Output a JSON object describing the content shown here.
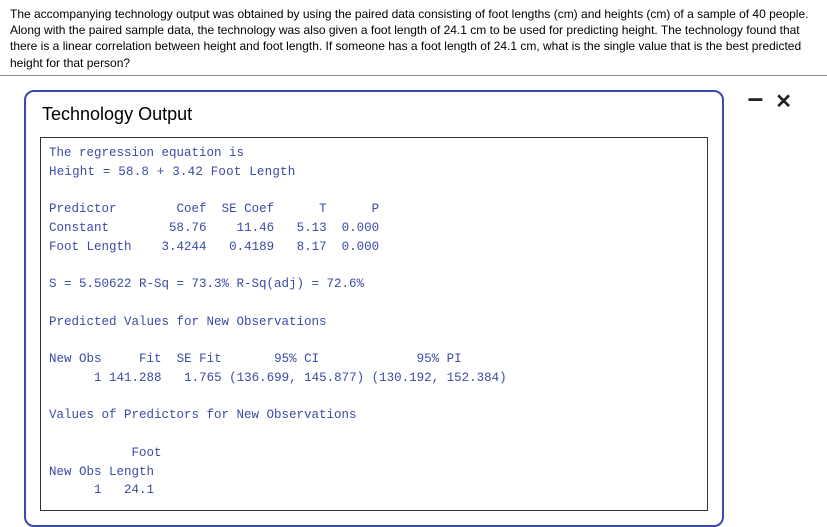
{
  "problem": "The accompanying technology output was obtained by using the paired data consisting of foot lengths (cm) and heights (cm) of a sample of 40 people. Along with the paired sample data, the technology was also given a foot length of 24.1 cm to be used for predicting height. The technology found that there is a linear correlation between height and foot length. If someone has a foot length of 24.1 cm, what is the single value that is the best predicted height for that person?",
  "panel_title": "Technology Output",
  "controls": {
    "minimize": "–",
    "close": "✕"
  },
  "reg": {
    "header": "The regression equation is",
    "equation": "Height = 58.8 + 3.42 Foot Length"
  },
  "pred_table": {
    "h1": "Predictor",
    "h2": "Coef",
    "h3": "SE Coef",
    "h4": "T",
    "h5": "P",
    "r1c1": "Constant",
    "r1c2": "58.76",
    "r1c3": "11.46",
    "r1c4": "5.13",
    "r1c5": "0.000",
    "r2c1": "Foot Length",
    "r2c2": "3.4244",
    "r2c3": "0.4189",
    "r2c4": "8.17",
    "r2c5": "0.000"
  },
  "stats": "S = 5.50622 R-Sq = 73.3% R-Sq(adj) = 72.6%",
  "pred_section": "Predicted Values for New Observations",
  "newobs": {
    "h1": "New Obs",
    "h2": "Fit",
    "h3": "SE Fit",
    "h4": "95% CI",
    "h5": "95% PI",
    "r1c1": "1",
    "r1c2": "141.288",
    "r1c3": "1.765",
    "r1c4": "(136.699, 145.877)",
    "r1c5": "(130.192, 152.384)"
  },
  "values_section": "Values of Predictors for New Observations",
  "values": {
    "h1": "Foot",
    "h2a": "New Obs",
    "h2b": "Length",
    "r1c1": "1",
    "r1c2": "24.1"
  }
}
